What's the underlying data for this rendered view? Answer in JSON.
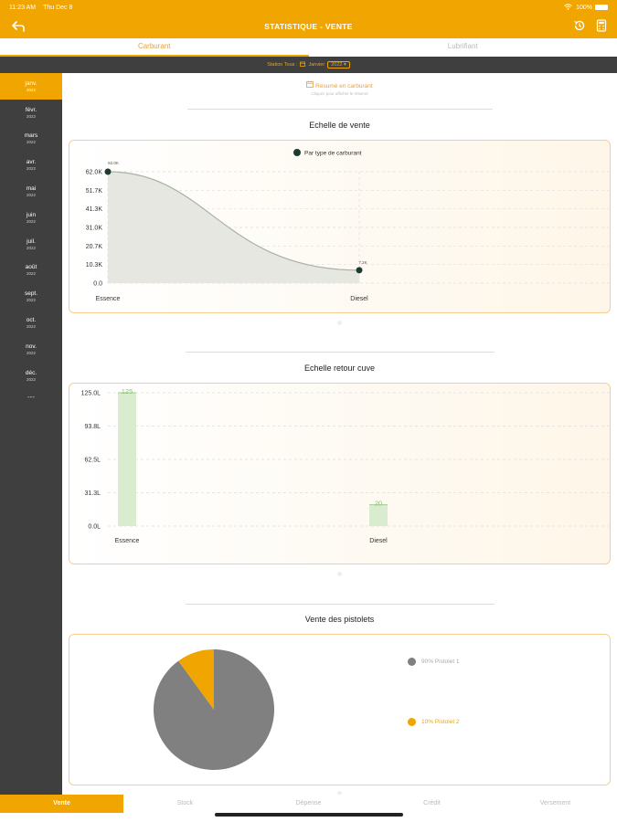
{
  "status": {
    "time": "11:23 AM",
    "date": "Thu Dec 8",
    "battery": "100%"
  },
  "header": {
    "title": "STATISTIQUE - VENTE"
  },
  "tabs": [
    {
      "label": "Carburant"
    },
    {
      "label": "Lubrifiant"
    }
  ],
  "filter": {
    "station": "Station Tous :",
    "month": "Janvier",
    "year": "2022"
  },
  "sidebar": {
    "months": [
      {
        "m": "janv.",
        "y": "2022"
      },
      {
        "m": "févr.",
        "y": "2022"
      },
      {
        "m": "mars",
        "y": "2022"
      },
      {
        "m": "avr.",
        "y": "2022"
      },
      {
        "m": "mai",
        "y": "2022"
      },
      {
        "m": "juin",
        "y": "2022"
      },
      {
        "m": "juil.",
        "y": "2022"
      },
      {
        "m": "août",
        "y": "2022"
      },
      {
        "m": "sept.",
        "y": "2022"
      },
      {
        "m": "oct.",
        "y": "2022"
      },
      {
        "m": "nov.",
        "y": "2022"
      },
      {
        "m": "déc.",
        "y": "2022"
      }
    ],
    "more": "---"
  },
  "summary": {
    "label": "Résumé en carburant",
    "sub": "Cliquez pour afficher le résumé"
  },
  "sections": {
    "sales_scale": "Echelle de vente",
    "tank_return": "Echelle retour cuve",
    "pistol_sales": "Vente des pistolets"
  },
  "colors": {
    "accent": "#f0a500",
    "dark": "#3f3f3f",
    "series_dark": "#1d3b2e",
    "pie_gray": "#808080",
    "bar_green": "#d9ecd0"
  },
  "chart_data": [
    {
      "type": "area",
      "title": "Echelle de vente",
      "legend": "Par type de carburant",
      "categories": [
        "Essence",
        "Diesel"
      ],
      "series": [
        {
          "name": "Par type de carburant",
          "values": [
            62000,
            7200
          ]
        }
      ],
      "data_labels": [
        "62.0K",
        "7.2K"
      ],
      "yticks": [
        "0.0",
        "10.3K",
        "20.7K",
        "31.0K",
        "41.3K",
        "51.7K",
        "62.0K"
      ],
      "ylim": [
        0,
        62000
      ],
      "grid": true
    },
    {
      "type": "bar",
      "title": "Echelle retour cuve",
      "categories": [
        "Essence",
        "Diesel"
      ],
      "values": [
        125,
        20
      ],
      "data_labels": [
        "125",
        "20"
      ],
      "yticks": [
        "0.0L",
        "31.3L",
        "62.5L",
        "93.8L",
        "125.0L"
      ],
      "ylim": [
        0,
        125
      ],
      "grid": true
    },
    {
      "type": "pie",
      "title": "Vente des pistolets",
      "slices": [
        {
          "label": "90% Pistolet 1",
          "value": 90,
          "color": "#808080"
        },
        {
          "label": "10% Pistolet 2",
          "value": 10,
          "color": "#f0a500"
        }
      ],
      "legend": "right"
    }
  ],
  "bottom_nav": [
    {
      "label": "Vente"
    },
    {
      "label": "Stock"
    },
    {
      "label": "Dépense"
    },
    {
      "label": "Crédit"
    },
    {
      "label": "Versement"
    }
  ]
}
